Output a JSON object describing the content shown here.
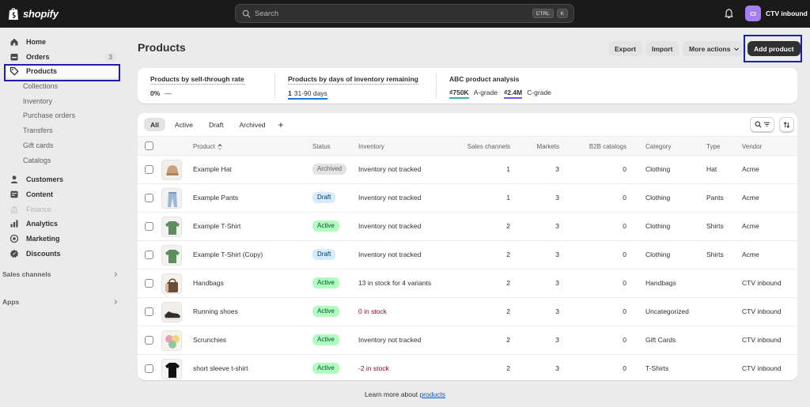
{
  "topbar": {
    "brand": "shopify",
    "search_placeholder": "Search",
    "shortcut_key1": "CTRL",
    "shortcut_key2": "K",
    "avatar_initials": "CI",
    "store_name": "CTV inbound"
  },
  "sidebar": {
    "home": "Home",
    "orders": "Orders",
    "orders_badge": "3",
    "products": "Products",
    "collections": "Collections",
    "inventory": "Inventory",
    "purchase_orders": "Purchase orders",
    "transfers": "Transfers",
    "gift_cards": "Gift cards",
    "catalogs": "Catalogs",
    "customers": "Customers",
    "content": "Content",
    "finance": "Finance",
    "analytics": "Analytics",
    "marketing": "Marketing",
    "discounts": "Discounts",
    "sales_channels": "Sales channels",
    "apps": "Apps"
  },
  "page": {
    "title": "Products",
    "export": "Export",
    "import": "Import",
    "more_actions": "More actions",
    "add_product": "Add product"
  },
  "metrics": {
    "sell_through": {
      "title": "Products by sell-through rate",
      "value": "0%",
      "dash": "—"
    },
    "days_inventory": {
      "title": "Products by days of inventory remaining",
      "count": "1",
      "range": "31-90 days"
    },
    "abc": {
      "title": "ABC product analysis",
      "a_value": "₫750K",
      "a_label": "A-grade",
      "c_value": "₫2.4M",
      "c_label": "C-grade"
    }
  },
  "colors": {
    "teal_underline": "#36b3a8",
    "purple_underline": "#8051e6",
    "blue_underline": "#1f7ad6"
  },
  "tabs": {
    "all": "All",
    "active": "Active",
    "draft": "Draft",
    "archived": "Archived",
    "add": "+"
  },
  "table": {
    "headers": {
      "product": "Product",
      "status": "Status",
      "inventory": "Inventory",
      "sales_channels": "Sales channels",
      "markets": "Markets",
      "b2b": "B2B catalogs",
      "category": "Category",
      "type": "Type",
      "vendor": "Vendor"
    },
    "rows": [
      {
        "name": "Example Hat",
        "status": "Archived",
        "inventory": "Inventory not tracked",
        "channels": "1",
        "markets": "3",
        "b2b": "0",
        "category": "Clothing",
        "type": "Hat",
        "vendor": "Acme",
        "thumb": "hat"
      },
      {
        "name": "Example Pants",
        "status": "Draft",
        "inventory": "Inventory not tracked",
        "channels": "1",
        "markets": "3",
        "b2b": "0",
        "category": "Clothing",
        "type": "Pants",
        "vendor": "Acme",
        "thumb": "pants"
      },
      {
        "name": "Example T-Shirt",
        "status": "Active",
        "inventory": "Inventory not tracked",
        "channels": "2",
        "markets": "3",
        "b2b": "0",
        "category": "Clothing",
        "type": "Shirts",
        "vendor": "Acme",
        "thumb": "tshirt"
      },
      {
        "name": "Example T-Shirt (Copy)",
        "status": "Draft",
        "inventory": "Inventory not tracked",
        "channels": "2",
        "markets": "3",
        "b2b": "0",
        "category": "Clothing",
        "type": "Shirts",
        "vendor": "Acme",
        "thumb": "tshirt"
      },
      {
        "name": "Handbags",
        "status": "Active",
        "inventory": "13 in stock for 4 variants",
        "channels": "2",
        "markets": "3",
        "b2b": "0",
        "category": "Handbags",
        "type": "",
        "vendor": "CTV inbound",
        "thumb": "handbag"
      },
      {
        "name": "Running shoes",
        "status": "Active",
        "inventory": "0 in stock",
        "inv_alert": true,
        "channels": "2",
        "markets": "3",
        "b2b": "0",
        "category": "Uncategorized",
        "type": "",
        "vendor": "CTV inbound",
        "thumb": "shoes"
      },
      {
        "name": "Scrunchies",
        "status": "Active",
        "inventory": "Inventory not tracked",
        "channels": "2",
        "markets": "3",
        "b2b": "0",
        "category": "Gift Cards",
        "type": "",
        "vendor": "CTV inbound",
        "thumb": "scrunchies"
      },
      {
        "name": "short sleeve t-shirt",
        "status": "Active",
        "inventory": "-2 in stock",
        "inv_alert": true,
        "channels": "2",
        "markets": "3",
        "b2b": "0",
        "category": "T-Shirts",
        "type": "",
        "vendor": "CTV inbound",
        "thumb": "blackshirt"
      }
    ]
  },
  "footer": {
    "text": "Learn more about",
    "link": "products"
  }
}
